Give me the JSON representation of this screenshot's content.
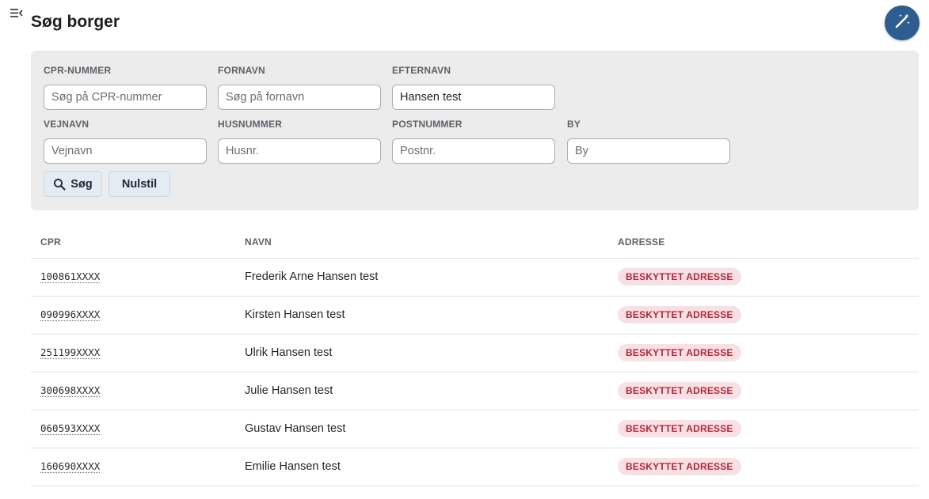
{
  "header": {
    "title": "Søg borger"
  },
  "search": {
    "fields": {
      "cpr": {
        "label": "CPR-NUMMER",
        "placeholder": "Søg på CPR-nummer",
        "value": ""
      },
      "fornavn": {
        "label": "FORNAVN",
        "placeholder": "Søg på fornavn",
        "value": ""
      },
      "efternavn": {
        "label": "EFTERNAVN",
        "placeholder": "",
        "value": "Hansen test"
      },
      "vejnavn": {
        "label": "VEJNAVN",
        "placeholder": "Vejnavn",
        "value": ""
      },
      "husnummer": {
        "label": "HUSNUMMER",
        "placeholder": "Husnr.",
        "value": ""
      },
      "postnummer": {
        "label": "POSTNUMMER",
        "placeholder": "Postnr.",
        "value": ""
      },
      "by": {
        "label": "BY",
        "placeholder": "By",
        "value": ""
      }
    },
    "search_button": "Søg",
    "reset_button": "Nulstil"
  },
  "table": {
    "columns": [
      "CPR",
      "NAVN",
      "ADRESSE"
    ],
    "rows": [
      {
        "cpr": "100861XXXX",
        "name": "Frederik Arne Hansen test",
        "address": "BESKYTTET ADRESSE"
      },
      {
        "cpr": "090996XXXX",
        "name": "Kirsten Hansen test",
        "address": "BESKYTTET ADRESSE"
      },
      {
        "cpr": "251199XXXX",
        "name": "Ulrik Hansen test",
        "address": "BESKYTTET ADRESSE"
      },
      {
        "cpr": "300698XXXX",
        "name": "Julie Hansen test",
        "address": "BESKYTTET ADRESSE"
      },
      {
        "cpr": "060593XXXX",
        "name": "Gustav Hansen test",
        "address": "BESKYTTET ADRESSE"
      },
      {
        "cpr": "160690XXXX",
        "name": "Emilie Hansen test",
        "address": "BESKYTTET ADRESSE"
      }
    ]
  },
  "icons": {
    "menu": "menu-collapse-icon",
    "magic": "magic-wand-icon",
    "search": "search-icon"
  },
  "colors": {
    "primary": "#2e5d91",
    "panel_bg": "#ececed",
    "badge_bg": "#f8e1e4",
    "badge_text": "#b3263a"
  }
}
